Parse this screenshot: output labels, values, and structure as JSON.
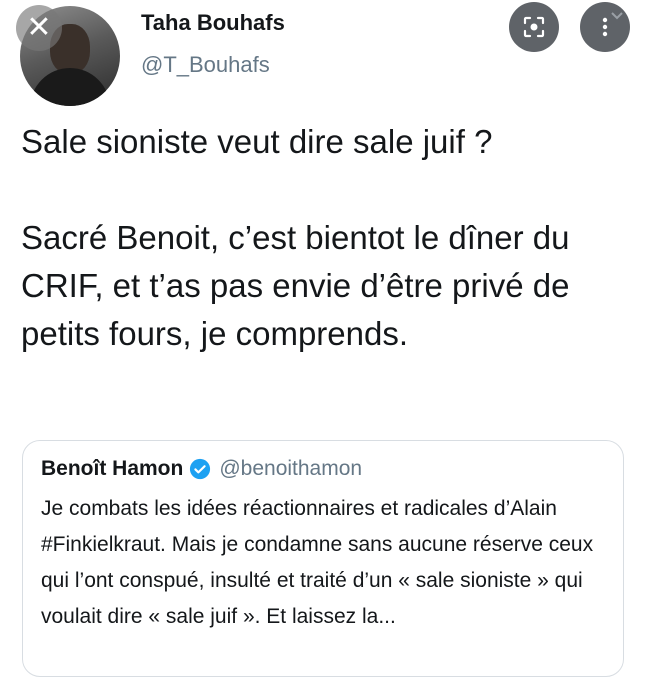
{
  "tweet": {
    "author_name": "Taha Bouhafs",
    "author_handle": "@T_Bouhafs",
    "paragraphs": [
      "Sale sioniste veut dire sale juif ?",
      "Sacré Benoit, c’est bientot le dîner du CRIF, et t’as pas envie d’être privé de petits fours, je comprends."
    ]
  },
  "quoted_tweet": {
    "author_name": "Benoît Hamon",
    "author_handle": "@benoithamon",
    "verified": true,
    "text": "Je combats les idées réactionnaires et radicales d’Alain #Finkielkraut. Mais je condamne sans aucune réserve ceux qui l’ont conspué, insulté et traité d’un « sale sioniste » qui voulait dire « sale juif ». Et laissez la..."
  },
  "overlay": {
    "close_glyph": "✕",
    "icons": [
      "close-icon",
      "lens-icon",
      "more-vert-icon",
      "chevron-down-icon",
      "verified-badge-icon"
    ]
  },
  "colors": {
    "text": "#14171a",
    "secondary": "#657786",
    "verified": "#1da1f2",
    "overlay_button": "#5f6368"
  }
}
